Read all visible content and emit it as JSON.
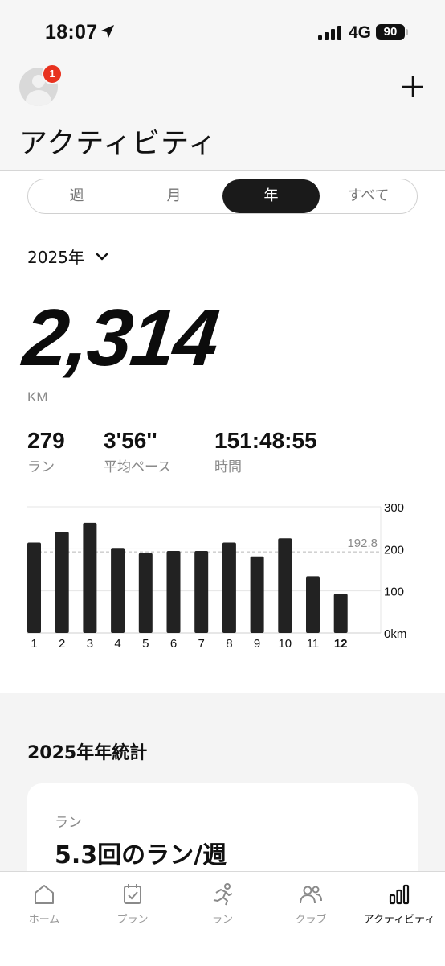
{
  "status_bar": {
    "time": "18:07",
    "network": "4G",
    "battery": "90"
  },
  "header": {
    "notification_count": "1",
    "title": "アクティビティ"
  },
  "tabs": [
    {
      "label": "週",
      "active": false
    },
    {
      "label": "月",
      "active": false
    },
    {
      "label": "年",
      "active": true
    },
    {
      "label": "すべて",
      "active": false
    }
  ],
  "year_selector": {
    "label": "2025年"
  },
  "summary": {
    "total_distance": "2,314",
    "distance_unit": "KM",
    "runs_value": "279",
    "runs_label": "ラン",
    "pace_value": "3'56''",
    "pace_label": "平均ペース",
    "time_value": "151:48:55",
    "time_label": "時間"
  },
  "chart_data": {
    "type": "bar",
    "categories": [
      "1",
      "2",
      "3",
      "4",
      "5",
      "6",
      "7",
      "8",
      "9",
      "10",
      "11",
      "12"
    ],
    "values": [
      215,
      240,
      262,
      202,
      190,
      195,
      195,
      215,
      182,
      225,
      135,
      93
    ],
    "y_ticks": [
      "300",
      "200",
      "100",
      "0km"
    ],
    "ylim": [
      0,
      300
    ],
    "average_label": "192.8",
    "average": 192.8,
    "bold_category": "12",
    "grid": true
  },
  "stats_section": {
    "title": "2025年年統計",
    "card_label": "ラン",
    "card_value": "5.3回のラン/週"
  },
  "tab_bar": [
    {
      "label": "ホーム",
      "icon": "home-icon",
      "active": false
    },
    {
      "label": "プラン",
      "icon": "plan-icon",
      "active": false
    },
    {
      "label": "ラン",
      "icon": "run-icon",
      "active": false
    },
    {
      "label": "クラブ",
      "icon": "club-icon",
      "active": false
    },
    {
      "label": "アクティビティ",
      "icon": "activity-icon",
      "active": true
    }
  ],
  "colors": {
    "header_bg": "#f6f6f6",
    "bar": "#222222",
    "active_segment": "#1a1a1a",
    "badge": "#e8321f",
    "muted_text": "#8a8a8a"
  }
}
